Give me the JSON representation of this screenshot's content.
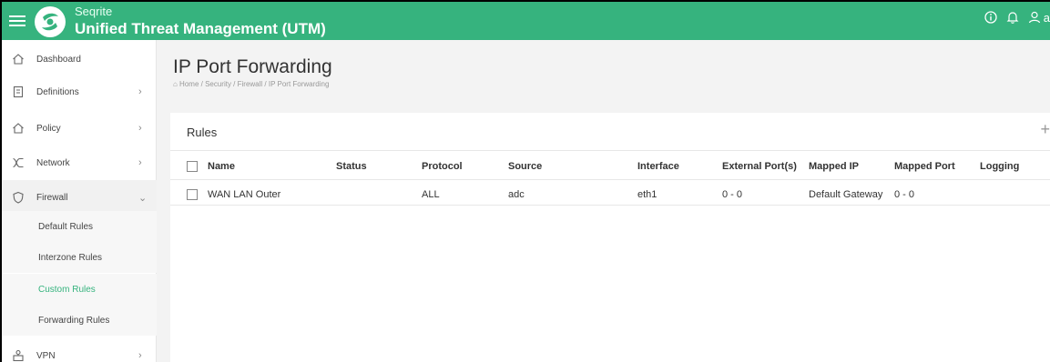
{
  "header": {
    "brand_small": "Seqrite",
    "brand_title": "Unified Threat Management (UTM)",
    "user_text": "a"
  },
  "sidebar": {
    "items": [
      {
        "label": "Dashboard",
        "icon": "home-icon"
      },
      {
        "label": "Definitions",
        "icon": "document-icon"
      },
      {
        "label": "Policy",
        "icon": "home-icon"
      },
      {
        "label": "Network",
        "icon": "network-icon"
      },
      {
        "label": "Firewall",
        "icon": "shield-icon"
      },
      {
        "label": "VPN",
        "icon": "vpn-icon"
      }
    ],
    "firewall_sub": [
      {
        "label": "Default Rules"
      },
      {
        "label": "Interzone Rules"
      },
      {
        "label": "Custom Rules"
      },
      {
        "label": "Forwarding Rules"
      }
    ]
  },
  "page": {
    "title": "IP Port Forwarding",
    "breadcrumb": "⌂ Home / Security / Firewall / IP Port Forwarding"
  },
  "rules": {
    "title": "Rules",
    "add_label": "+",
    "columns": [
      "Name",
      "Status",
      "Protocol",
      "Source",
      "Interface",
      "External Port(s)",
      "Mapped IP",
      "Mapped Port",
      "Logging"
    ],
    "rows": [
      {
        "name": "WAN LAN Outer",
        "status": "",
        "protocol": "ALL",
        "source": "adc",
        "interface": "eth1",
        "external_ports": "0 - 0",
        "mapped_ip": "Default Gateway",
        "mapped_port": "0 - 0",
        "logging": ""
      }
    ]
  },
  "colors": {
    "accent": "#36b37e",
    "active_link": "#36b37e"
  }
}
